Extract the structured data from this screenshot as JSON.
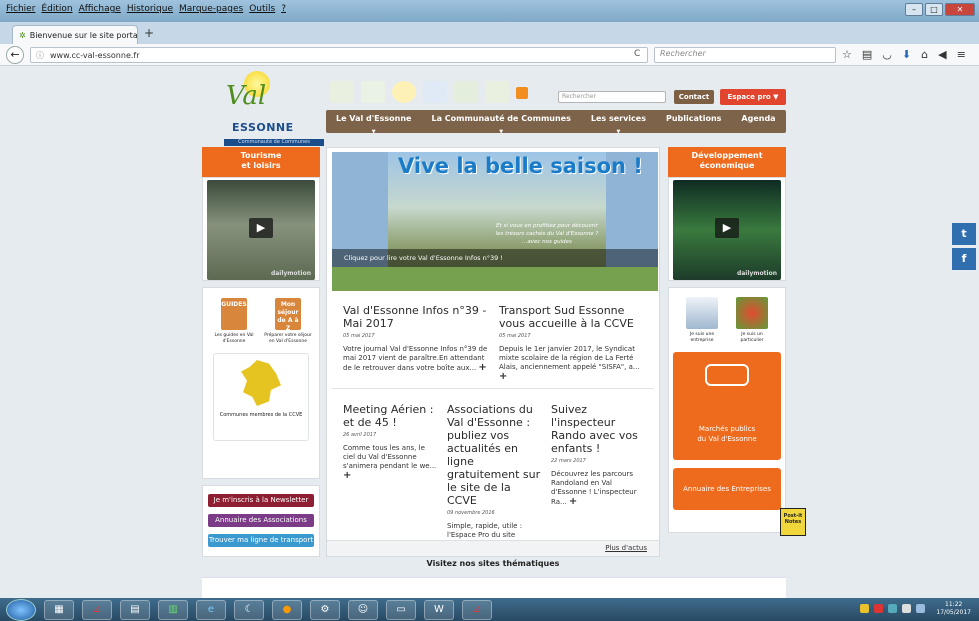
{
  "browser": {
    "menu": [
      "Fichier",
      "Édition",
      "Affichage",
      "Historique",
      "Marque-pages",
      "Outils",
      "?"
    ],
    "tab_title": "Bienvenue sur le site portail c",
    "tab_close": "×",
    "new_tab": "+",
    "url": "www.cc-val-essonne.fr",
    "search_placeholder": "Rechercher"
  },
  "site": {
    "logo_val": "Val",
    "logo_essonne": "ESSONNE",
    "logo_cc": "Communauté de Communes",
    "search_placeholder": "Rechercher",
    "contact": "Contact",
    "espace_pro": "Espace pro ▼",
    "nav": [
      "Le Val d'Essonne",
      "La Communauté de Communes",
      "Les services",
      "Publications",
      "Agenda"
    ]
  },
  "left": {
    "heading": "Tourisme\net loisirs",
    "video_brand": "dailymotion",
    "guide1_label": "Les guides en Val d'Essonne",
    "guide1_img": "GUIDES",
    "guide2_label": "Préparer votre séjour en Val d'Essonne",
    "guide2_img": "Mon séjour de A à Z",
    "map_label": "Communes membres de la CCVE",
    "newsletter": "Je m'inscris à la Newsletter",
    "annuaire_assoc": "Annuaire des Associations",
    "transport": "Trouver ma ligne de transport",
    "colors": {
      "newsletter": "#8e1f33",
      "assoc": "#7b3b86",
      "transport": "#3a9ad0"
    }
  },
  "banner": {
    "title": "Vive la belle saison !",
    "tagline": "Et si vous en profitiez pour découvrir les trésors cachés du Val d'Essonne ? ...avec nos guides",
    "caption": "Cliquez pour lire votre Val d'Essonne Infos n°39 !"
  },
  "news": [
    {
      "title": "Val d'Essonne Infos n°39 - Mai 2017",
      "date": "05 mai 2017",
      "text": "Votre journal Val d'Essonne Infos n°39 de mai 2017 vient de paraître.En attendant de le retrouver dans votre boîte aux..."
    },
    {
      "title": "Transport Sud Essonne vous accueille à la CCVE",
      "date": "05 mai 2017",
      "text": "Depuis le 1er janvier 2017, le Syndicat mixte scolaire de la région de La Ferté Alais, anciennement appelé \"SISFA\", a..."
    },
    {
      "title": "Meeting Aérien : et de 45 !",
      "date": "26 avril 2017",
      "text": "Comme tous les ans, le ciel du Val d'Essonne s'animera pendant le we..."
    },
    {
      "title": "Associations du Val d'Essonne : publiez vos actualités en ligne gratuitement sur le site de la CCVE",
      "date": "09 novembre 2016",
      "text": "Simple, rapide, utile : l'Espace Pro du site Internet de la Communauté de..."
    },
    {
      "title": "Suivez l'inspecteur Rando avec vos enfants !",
      "date": "22 mars 2017",
      "text": "Découvrez les parcours Randoland en Val d'Essonne ! L'inspecteur Ra..."
    }
  ],
  "more_news": "Plus d'actus",
  "right": {
    "heading": "Développement\néconomique",
    "video_brand": "dailymotion",
    "entreprise": "Je suis une entreprise",
    "particulier": "Je suis un particulier",
    "marches": "Marchés publics\ndu Val d'Essonne",
    "annuaire": "Annuaire des Entreprises"
  },
  "thematic": "Visitez nos sites thématiques",
  "social": {
    "twitter": "t",
    "facebook": "f"
  },
  "postit": "Post-it Notes",
  "taskbar": {
    "time": "11:22",
    "date": "17/05/2017"
  }
}
